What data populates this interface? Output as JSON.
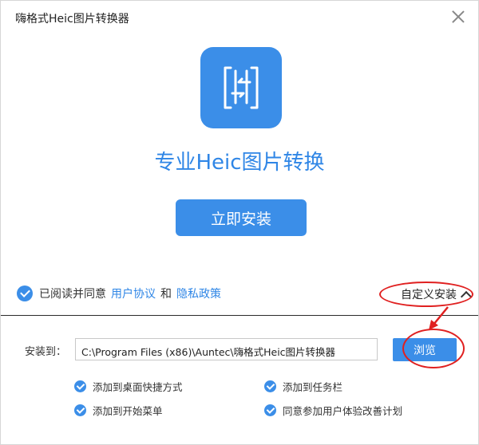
{
  "window": {
    "title": "嗨格式Heic图片转换器"
  },
  "main": {
    "heading": "专业Heic图片转换",
    "install_label": "立即安装"
  },
  "agreement": {
    "prefix": "已阅读并同意",
    "user_agreement": "用户协议",
    "and": "和",
    "privacy_policy": "隐私政策"
  },
  "custom_install": {
    "label": "自定义安装"
  },
  "install_path": {
    "label": "安装到：",
    "value": "C:\\Program Files (x86)\\Auntec\\嗨格式Heic图片转换器",
    "browse_label": "浏览"
  },
  "options": [
    {
      "label": "添加到桌面快捷方式",
      "checked": true
    },
    {
      "label": "添加到任务栏",
      "checked": true
    },
    {
      "label": "添加到开始菜单",
      "checked": true
    },
    {
      "label": "同意参加用户体验改善计划",
      "checked": true
    }
  ],
  "colors": {
    "accent": "#3b8ee8",
    "heading": "#2f86e6",
    "annotation": "#e02020"
  }
}
